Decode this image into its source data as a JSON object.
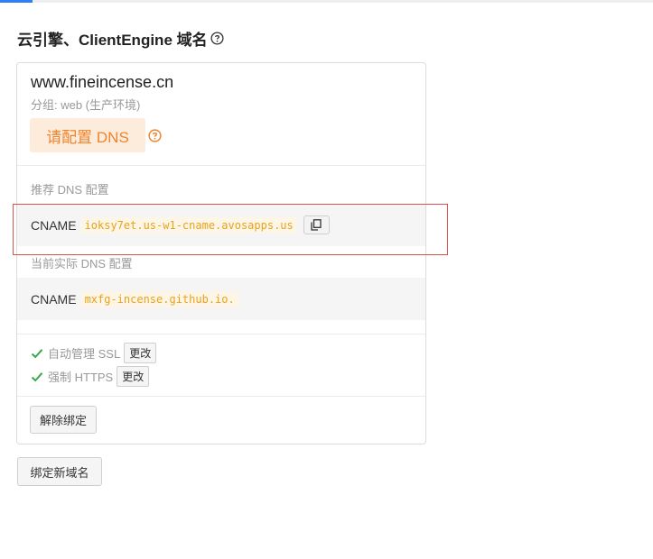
{
  "page": {
    "title": "云引擎、ClientEngine 域名"
  },
  "domain_card": {
    "domain": "www.fineincense.cn",
    "group": "分组: web (生产环境)",
    "warning": "请配置 DNS",
    "recommended_label": "推荐 DNS 配置",
    "recommended": {
      "type": "CNAME",
      "value": "ioksy7et.us-w1-cname.avosapps.us"
    },
    "current_label": "当前实际 DNS 配置",
    "current": {
      "type": "CNAME",
      "value": "mxfg-incense.github.io."
    },
    "ssl_label": "自动管理 SSL",
    "https_label": "强制 HTTPS",
    "change_label": "更改",
    "unbind_label": "解除绑定"
  },
  "bind_new_label": "绑定新域名",
  "colors": {
    "accent": "#2f7ef5",
    "warning_text": "#f0842c",
    "warning_bg": "#fdebdc",
    "code_text": "#e8a21e",
    "check_green": "#3aa84a",
    "highlight_border": "#d9534f"
  }
}
